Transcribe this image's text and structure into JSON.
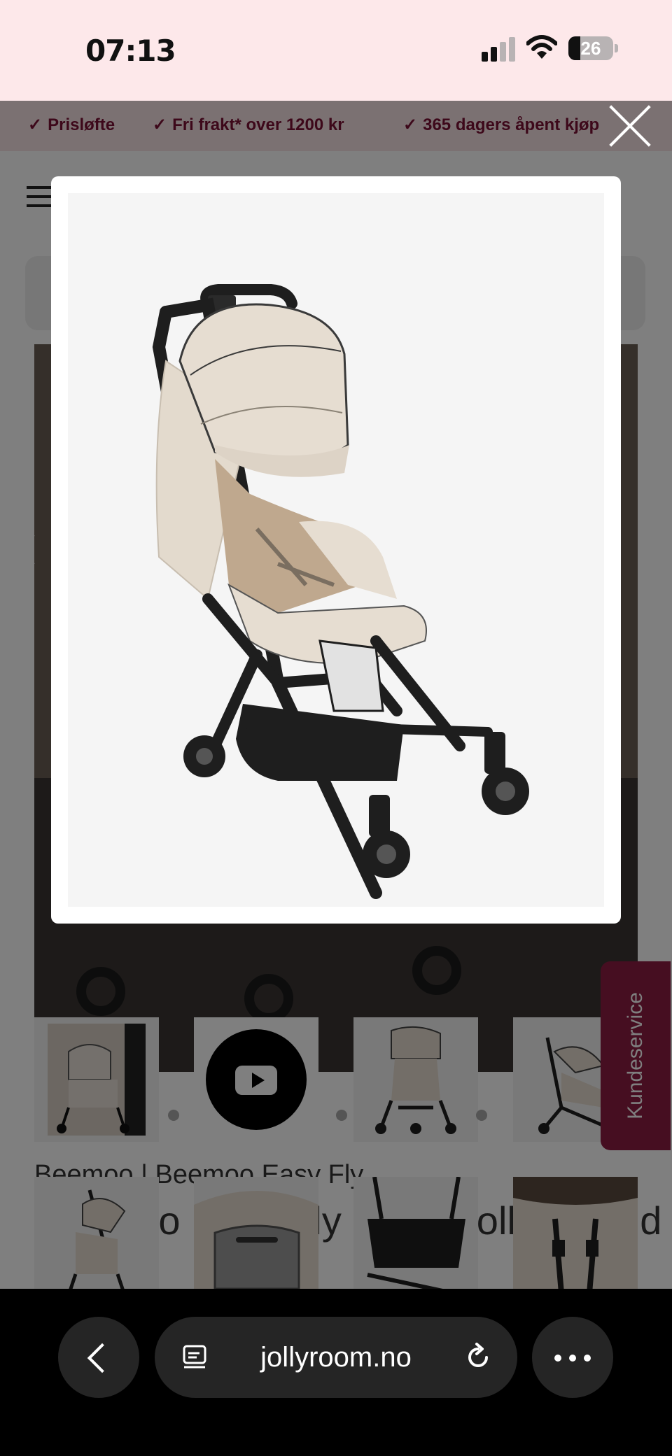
{
  "status_bar": {
    "time": "07:13",
    "battery": "26",
    "battery_level": 0.26
  },
  "usp_bar": {
    "items": [
      "Prisløfte",
      "Fri frakt* over 1200 kr",
      "365 dagers åpent kjøp"
    ]
  },
  "product": {
    "brand_line": "Beemoo | Beemoo Easy Fly",
    "title_partial": "Beemoo Easy Fly Lux Stroller, Sand",
    "kundeservice": "Kundeservice"
  },
  "thumbnails": [
    {
      "kind": "image",
      "icon": "stroller-lifestyle"
    },
    {
      "kind": "video",
      "icon": "youtube-play-icon"
    },
    {
      "kind": "image",
      "icon": "stroller-front"
    },
    {
      "kind": "image",
      "icon": "stroller-side"
    },
    {
      "kind": "image",
      "icon": "stroller-folded"
    },
    {
      "kind": "image",
      "icon": "canopy-detail"
    },
    {
      "kind": "image",
      "icon": "basket-detail"
    },
    {
      "kind": "image",
      "icon": "harness-detail"
    }
  ],
  "modal": {
    "image_alt": "Beemoo Easy Fly stroller in sand beige with black frame"
  },
  "browser": {
    "url": "jollyroom.no"
  },
  "colors": {
    "brand": "#8c1d42",
    "usp_text": "#7a1035",
    "status_bg": "#fde8ea",
    "toolbar_bg": "#000000",
    "stroller_fabric": "#e6ddd1",
    "stroller_frame": "#1e1e1e"
  }
}
